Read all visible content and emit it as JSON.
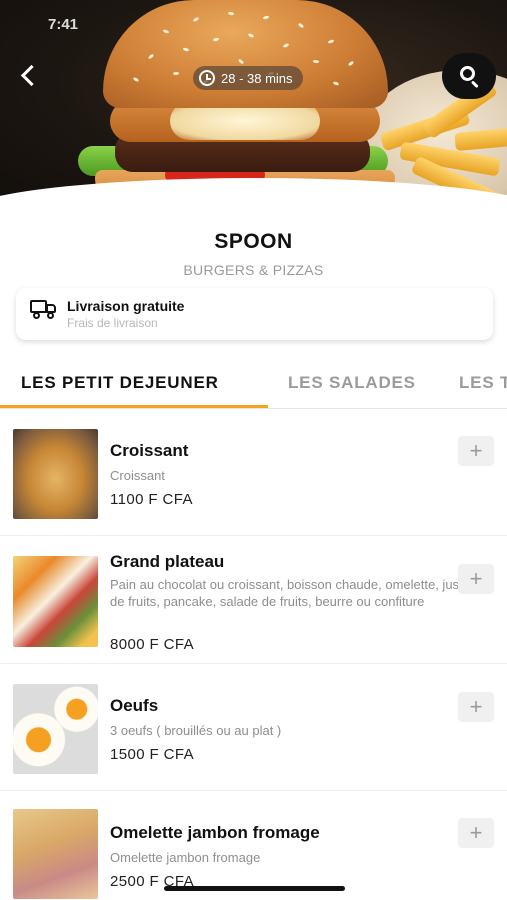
{
  "status_bar": {
    "time": "7:41"
  },
  "hero": {
    "eta": "28 - 38 mins"
  },
  "restaurant": {
    "name": "SPOON",
    "category": "BURGERS & PIZZAS"
  },
  "delivery": {
    "title": "Livraison gratuite",
    "subtitle": "Frais de livraison"
  },
  "tabs": [
    {
      "label": "LES PETIT DEJEUNER",
      "active": true
    },
    {
      "label": "LES SALADES",
      "active": false
    },
    {
      "label": "LES T",
      "active": false
    }
  ],
  "accent_color": "#f4a51c",
  "menu_items": [
    {
      "name": "Croissant",
      "description": "Croissant",
      "price": "1100 F CFA",
      "add_label": "+"
    },
    {
      "name": "Grand plateau",
      "description": "Pain au chocolat ou croissant, boisson chaude, omelette, jus de fruits, pancake, salade de fruits, beurre ou confiture",
      "price": "8000 F CFA",
      "add_label": "+"
    },
    {
      "name": "Oeufs",
      "description": "3 oeufs ( brouillés ou au plat )",
      "price": "1500 F CFA",
      "add_label": "+"
    },
    {
      "name": "Omelette jambon fromage",
      "description": "Omelette jambon fromage",
      "price": "2500 F CFA",
      "add_label": "+"
    }
  ]
}
